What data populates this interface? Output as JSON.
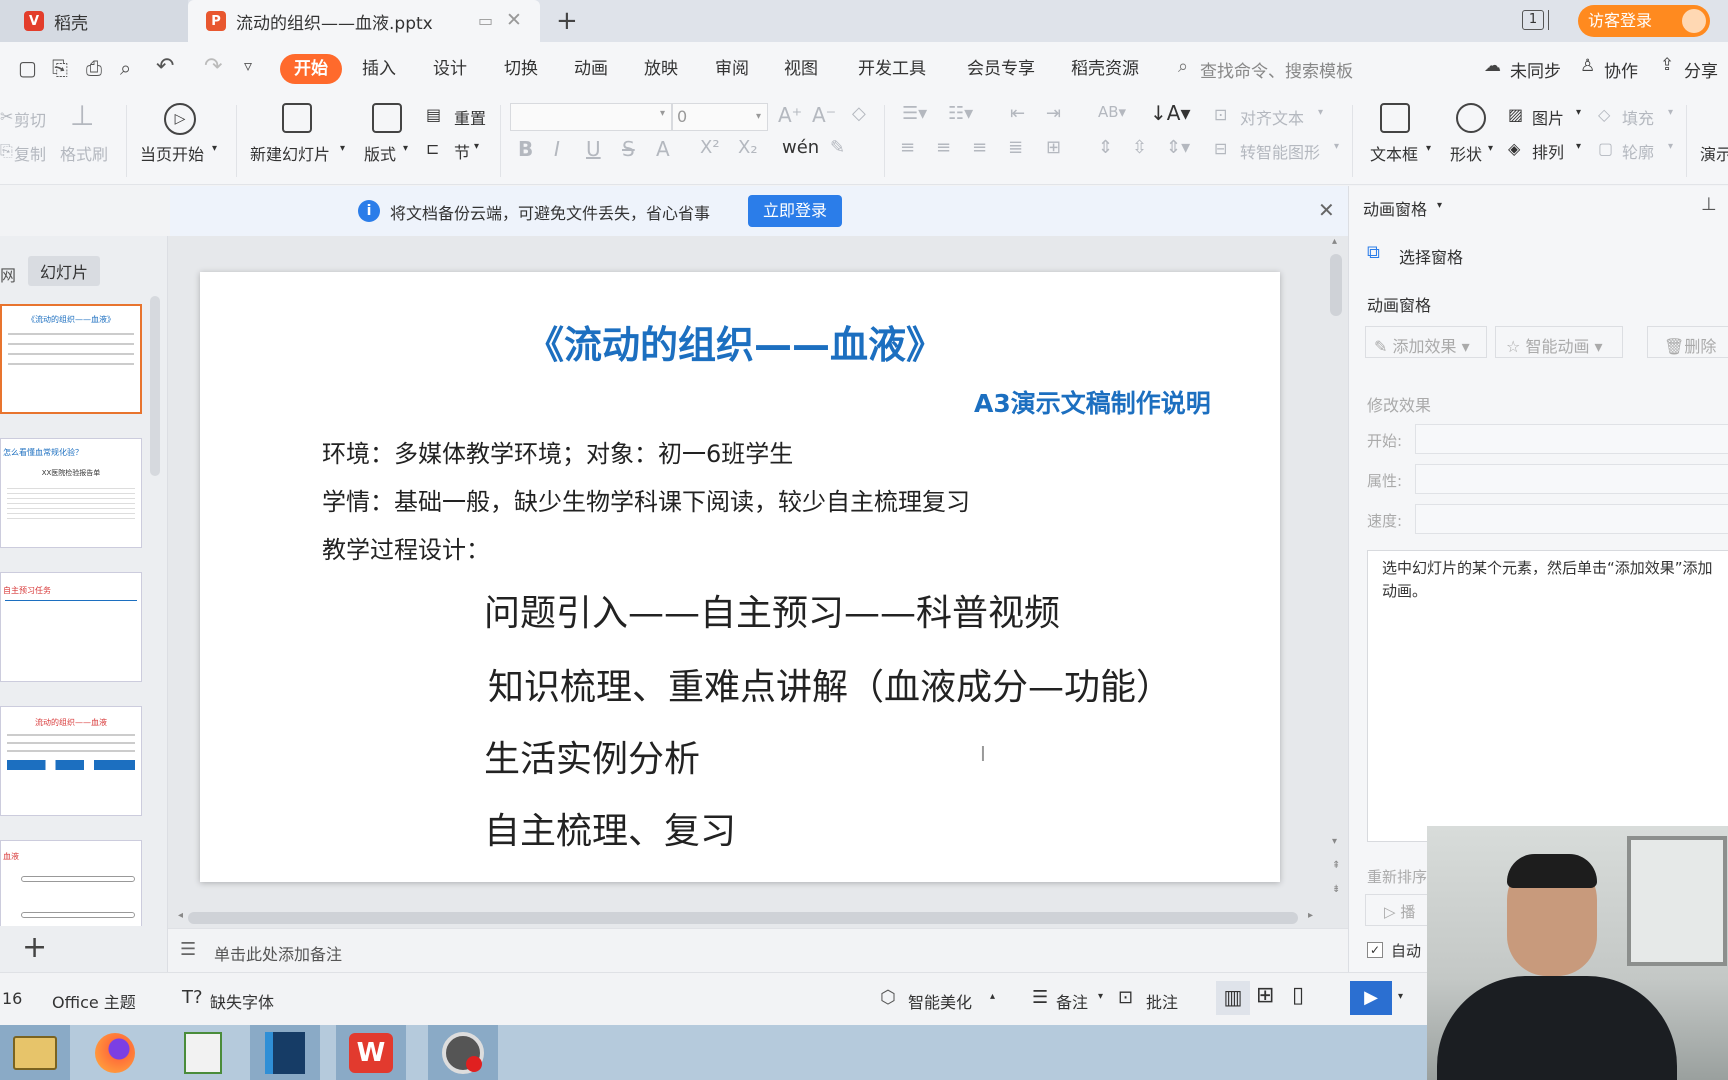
{
  "tabs": {
    "app_tab": "稻壳",
    "doc_tab": "流动的组织——血液.pptx",
    "new_tab": "+",
    "page_indicator": "1",
    "login_button": "访客登录"
  },
  "menu": {
    "items": [
      "开始",
      "插入",
      "设计",
      "切换",
      "动画",
      "放映",
      "审阅",
      "视图",
      "开发工具",
      "会员专享",
      "稻壳资源"
    ],
    "search": "查找命令、搜索模板",
    "sync": "未同步",
    "collab": "协作",
    "share": "分享"
  },
  "ribbon": {
    "cut": "剪切",
    "copy": "复制",
    "format_painter": "格式刷",
    "start_from_current": "当页开始",
    "new_slide": "新建幻灯片",
    "layout": "版式",
    "reset": "重置",
    "section": "节",
    "font_size": "0",
    "align_text": "对齐文本",
    "smart_shape": "转智能图形",
    "textbox": "文本框",
    "shape": "形状",
    "arrange": "排列",
    "picture": "图片",
    "fill": "填充",
    "outline": "轮廓",
    "present": "演示"
  },
  "notify": {
    "text": "将文档备份云端，可避免文件丢失，省心省事",
    "button": "立即登录"
  },
  "left_panel": {
    "tab_outline": "网",
    "tab_slides": "幻灯片",
    "thumbs": [
      {
        "title": "《流动的组织——血液》"
      },
      {
        "title": "怎么看懂血常规化验？",
        "sub": "XX医院检验报告单"
      },
      {
        "title": "自主预习任务"
      },
      {
        "title": "流动的组织——血液"
      },
      {
        "title": "血液"
      }
    ]
  },
  "slide": {
    "title": "《流动的组织——血液》",
    "subtitle": "A3演示文稿制作说明",
    "env": "环境：多媒体教学环境；对象：初一6班学生",
    "situation": "学情：基础一般，缺少生物学科课下阅读，较少自主梳理复习",
    "process_label": "教学过程设计：",
    "steps": [
      "问题引入——自主预习——科普视频",
      "知识梳理、重难点讲解（血液成分—功能）",
      "生活实例分析",
      "自主梳理、复习"
    ]
  },
  "notes": "单击此处添加备注",
  "right_pane": {
    "header": "动画窗格",
    "select_pane": "选择窗格",
    "section_title": "动画窗格",
    "add_effect": "添加效果",
    "smart_anim": "智能动画",
    "delete": "删除",
    "modify": "修改效果",
    "start": "开始:",
    "property": "属性:",
    "speed": "速度:",
    "hint": "选中幻灯片的某个元素，然后单击“添加效果”添加动画。",
    "reorder": "重新排序",
    "play": "播",
    "auto": "自动"
  },
  "status": {
    "page": "16",
    "theme": "Office 主题",
    "missing_font": "缺失字体",
    "beautify": "智能美化",
    "notes": "备注",
    "comments": "批注"
  },
  "colors": {
    "accent": "#ff6a2c",
    "slide_title": "#1c6fc0",
    "button_blue": "#2b7de9"
  }
}
